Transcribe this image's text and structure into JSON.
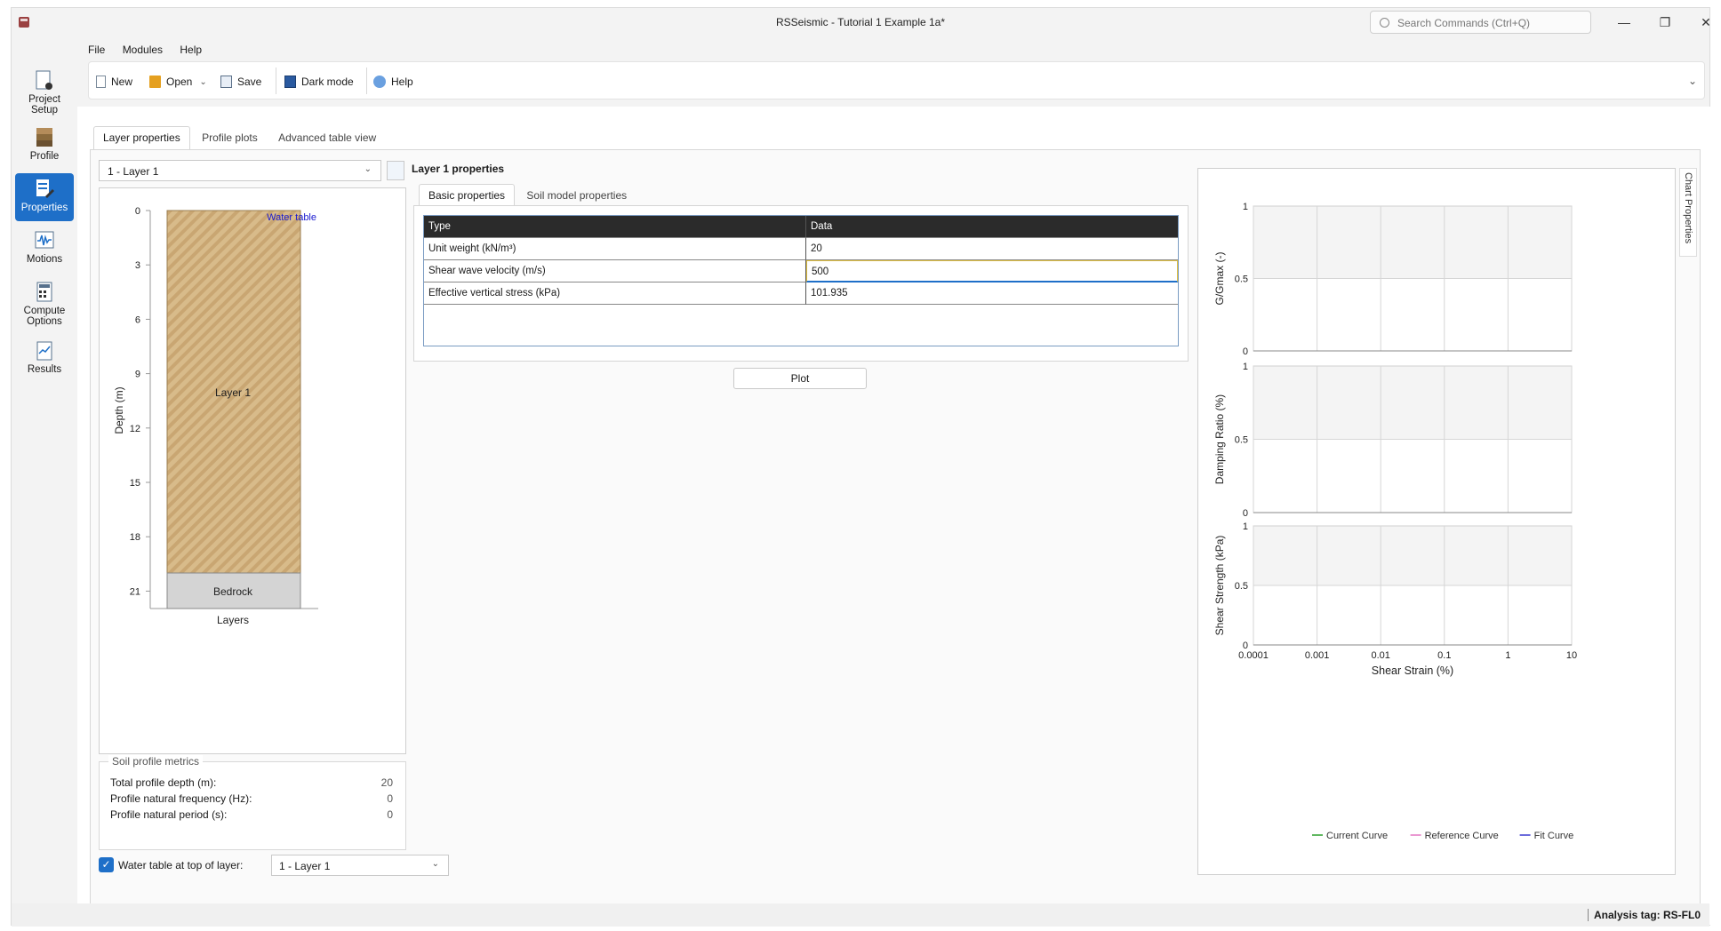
{
  "window": {
    "title": "RSSeismic - Tutorial 1 Example 1a*",
    "search_placeholder": "Search Commands (Ctrl+Q)"
  },
  "menu": [
    "File",
    "Modules",
    "Help"
  ],
  "toolbar": {
    "new": "New",
    "open": "Open",
    "save": "Save",
    "dark_mode": "Dark mode",
    "help": "Help"
  },
  "nav": {
    "project_setup": "Project Setup",
    "profile": "Profile",
    "properties": "Properties",
    "motions": "Motions",
    "compute_options": "Compute Options",
    "results": "Results",
    "selected": "Properties"
  },
  "tabs": [
    "Layer properties",
    "Profile plots",
    "Advanced table view"
  ],
  "layer_selector": {
    "value": "1 - Layer 1"
  },
  "profile": {
    "y_label": "Depth (m)",
    "x_label": "Layers",
    "y_ticks": [
      "0",
      "3",
      "6",
      "9",
      "12",
      "15",
      "18",
      "21"
    ],
    "layer_label": "Layer 1",
    "bedrock_label": "Bedrock",
    "water_table_label": "Water table",
    "layer_color": "#d8bb8a",
    "bedrock_color": "#d4d4d4"
  },
  "metrics": {
    "title": "Soil profile metrics",
    "rows": [
      {
        "label": "Total profile depth (m):",
        "value": "20"
      },
      {
        "label": "Profile natural frequency (Hz):",
        "value": "0"
      },
      {
        "label": "Profile natural period (s):",
        "value": "0"
      }
    ]
  },
  "water_table": {
    "checked": true,
    "label": "Water table at top of layer:",
    "value": "1 - Layer 1"
  },
  "properties": {
    "title": "Layer 1 properties",
    "subtabs": [
      "Basic properties",
      "Soil model properties"
    ],
    "headers": [
      "Type",
      "Data"
    ],
    "rows": [
      {
        "type": "Unit weight (kN/m³)",
        "data": "20"
      },
      {
        "type": "Shear wave velocity (m/s)",
        "data": "500"
      },
      {
        "type": "Effective vertical stress (kPa)",
        "data": "101.935"
      }
    ],
    "plot_button": "Plot"
  },
  "charts": {
    "panel_label": "Chart Properties",
    "x_label": "Shear Strain (%)",
    "x_ticks": [
      "0.0001",
      "0.001",
      "0.01",
      "0.1",
      "1",
      "10"
    ],
    "legend": [
      {
        "label": "Current Curve",
        "color": "#2ca02c"
      },
      {
        "label": "Reference Curve",
        "color": "#e377c2"
      },
      {
        "label": "Fit Curve",
        "color": "#3a3ad0"
      }
    ]
  },
  "chart_data": [
    {
      "type": "line",
      "ylabel": "G/Gmax (-)",
      "xlabel": "",
      "x_scale": "log",
      "xlim": [
        0.0001,
        10
      ],
      "ylim": [
        0,
        1
      ],
      "y_ticks": [
        "1",
        "0.5",
        "0"
      ],
      "series": [],
      "grid": true
    },
    {
      "type": "line",
      "ylabel": "Damping Ratio (%)",
      "xlabel": "",
      "x_scale": "log",
      "xlim": [
        0.0001,
        10
      ],
      "ylim": [
        0,
        1
      ],
      "y_ticks": [
        "1",
        "0.5",
        "0"
      ],
      "series": [],
      "grid": true
    },
    {
      "type": "line",
      "ylabel": "Shear Strength (kPa)",
      "xlabel": "Shear Strain (%)",
      "x_scale": "log",
      "xlim": [
        0.0001,
        10
      ],
      "ylim": [
        0,
        1
      ],
      "y_ticks": [
        "1",
        "0.5",
        "0"
      ],
      "series": [],
      "grid": true
    }
  ],
  "status": {
    "analysis_tag": "Analysis tag: RS-FL0"
  }
}
